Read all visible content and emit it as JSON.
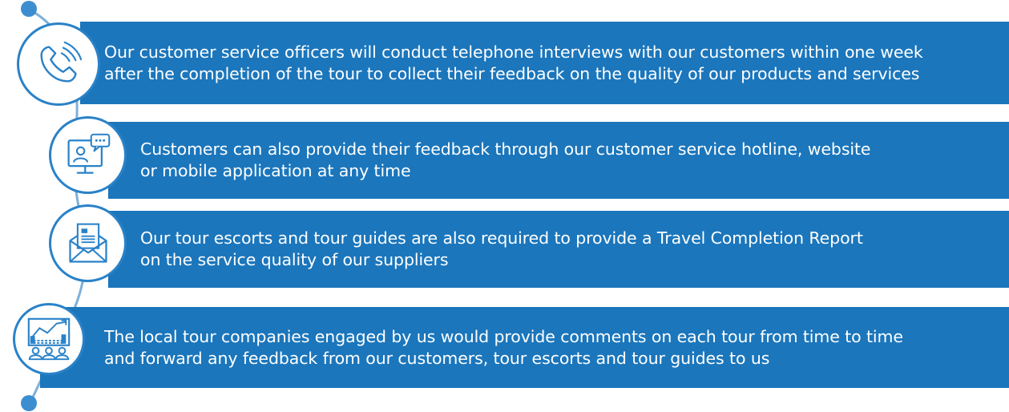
{
  "colors": {
    "band": "#1b76bc",
    "accent": "#2a82c8",
    "line": "#7fb0da",
    "dot": "#3d8ed0"
  },
  "steps": [
    {
      "icon": "phone-icon",
      "text": "Our customer service officers will conduct telephone interviews with our customers within one week\nafter the completion of the tour to collect their feedback on the quality of our products and services"
    },
    {
      "icon": "online-chat-icon",
      "text": "Customers can also provide their feedback through our customer service hotline, website\nor mobile application at any time"
    },
    {
      "icon": "envelope-icon",
      "text": "Our tour escorts and tour guides are also required to provide a Travel Completion Report\non the service quality of our suppliers"
    },
    {
      "icon": "analytics-group-icon",
      "text": "The local tour companies engaged by us would provide comments on each tour from time to time\nand forward any feedback from our customers, tour escorts and tour guides to us"
    }
  ]
}
